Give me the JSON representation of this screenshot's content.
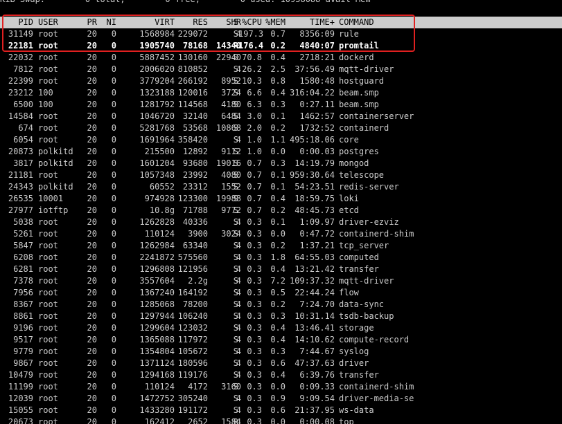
{
  "summary_line": "KiB Swap:        0 total,        0 free,        0 used. 10958088 avail Mem",
  "columns": {
    "pid": "PID",
    "user": "USER",
    "pr": "PR",
    "ni": "NI",
    "virt": "VIRT",
    "res": "RES",
    "shr": "SHR",
    "s": "S",
    "cpu": "%CPU",
    "mem": "%MEM",
    "time": "TIME+",
    "command": "COMMAND"
  },
  "processes": [
    {
      "pid": "31149",
      "user": "root",
      "pr": "20",
      "ni": "0",
      "virt": "1568984",
      "res": "229072",
      "shr": "4",
      "s": "S",
      "cpu": "197.3",
      "mem": "0.7",
      "time": "8356:09",
      "command": "rule",
      "bold": false
    },
    {
      "pid": "22181",
      "user": "root",
      "pr": "20",
      "ni": "0",
      "virt": "1905740",
      "res": "78168",
      "shr": "14340",
      "s": "R",
      "cpu": "176.4",
      "mem": "0.2",
      "time": "4840:07",
      "command": "promtail",
      "bold": true
    },
    {
      "pid": "22032",
      "user": "root",
      "pr": "20",
      "ni": "0",
      "virt": "5887452",
      "res": "130160",
      "shr": "22940",
      "s": "S",
      "cpu": "70.8",
      "mem": "0.4",
      "time": "2718:21",
      "command": "dockerd",
      "bold": false
    },
    {
      "pid": "7812",
      "user": "root",
      "pr": "20",
      "ni": "0",
      "virt": "2006020",
      "res": "810852",
      "shr": "4",
      "s": "S",
      "cpu": "26.2",
      "mem": "2.5",
      "time": "37:56.49",
      "command": "mqtt-driver",
      "bold": false
    },
    {
      "pid": "22399",
      "user": "root",
      "pr": "20",
      "ni": "0",
      "virt": "3779204",
      "res": "266192",
      "shr": "8952",
      "s": "S",
      "cpu": "10.3",
      "mem": "0.8",
      "time": "1580:48",
      "command": "hostguard",
      "bold": false
    },
    {
      "pid": "23212",
      "user": "100",
      "pr": "20",
      "ni": "0",
      "virt": "1323188",
      "res": "120016",
      "shr": "3724",
      "s": "S",
      "cpu": "6.6",
      "mem": "0.4",
      "time": "316:04.22",
      "command": "beam.smp",
      "bold": false
    },
    {
      "pid": "6500",
      "user": "100",
      "pr": "20",
      "ni": "0",
      "virt": "1281792",
      "res": "114568",
      "shr": "4180",
      "s": "S",
      "cpu": "6.3",
      "mem": "0.3",
      "time": "0:27.11",
      "command": "beam.smp",
      "bold": false
    },
    {
      "pid": "14584",
      "user": "root",
      "pr": "20",
      "ni": "0",
      "virt": "1046720",
      "res": "32140",
      "shr": "6484",
      "s": "S",
      "cpu": "3.0",
      "mem": "0.1",
      "time": "1462:57",
      "command": "containerserver",
      "bold": false
    },
    {
      "pid": "674",
      "user": "root",
      "pr": "20",
      "ni": "0",
      "virt": "5281768",
      "res": "53568",
      "shr": "10868",
      "s": "S",
      "cpu": "2.0",
      "mem": "0.2",
      "time": "1732:52",
      "command": "containerd",
      "bold": false
    },
    {
      "pid": "6054",
      "user": "root",
      "pr": "20",
      "ni": "0",
      "virt": "1691964",
      "res": "358420",
      "shr": "4",
      "s": "S",
      "cpu": "1.0",
      "mem": "1.1",
      "time": "495:18.06",
      "command": "core",
      "bold": false
    },
    {
      "pid": "20873",
      "user": "polkitd",
      "pr": "20",
      "ni": "0",
      "virt": "215500",
      "res": "12892",
      "shr": "9112",
      "s": "S",
      "cpu": "1.0",
      "mem": "0.0",
      "time": "0:00.03",
      "command": "postgres",
      "bold": false
    },
    {
      "pid": "3817",
      "user": "polkitd",
      "pr": "20",
      "ni": "0",
      "virt": "1601204",
      "res": "93680",
      "shr": "19016",
      "s": "S",
      "cpu": "0.7",
      "mem": "0.3",
      "time": "14:19.79",
      "command": "mongod",
      "bold": false
    },
    {
      "pid": "21181",
      "user": "root",
      "pr": "20",
      "ni": "0",
      "virt": "1057348",
      "res": "23992",
      "shr": "4080",
      "s": "S",
      "cpu": "0.7",
      "mem": "0.1",
      "time": "959:30.64",
      "command": "telescope",
      "bold": false
    },
    {
      "pid": "24343",
      "user": "polkitd",
      "pr": "20",
      "ni": "0",
      "virt": "60552",
      "res": "23312",
      "shr": "1552",
      "s": "S",
      "cpu": "0.7",
      "mem": "0.1",
      "time": "54:23.51",
      "command": "redis-server",
      "bold": false
    },
    {
      "pid": "26535",
      "user": "10001",
      "pr": "20",
      "ni": "0",
      "virt": "974928",
      "res": "123300",
      "shr": "19988",
      "s": "S",
      "cpu": "0.7",
      "mem": "0.4",
      "time": "18:59.75",
      "command": "loki",
      "bold": false
    },
    {
      "pid": "27977",
      "user": "iotftp",
      "pr": "20",
      "ni": "0",
      "virt": "10.8g",
      "res": "71788",
      "shr": "9772",
      "s": "S",
      "cpu": "0.7",
      "mem": "0.2",
      "time": "48:45.73",
      "command": "etcd",
      "bold": false
    },
    {
      "pid": "5038",
      "user": "root",
      "pr": "20",
      "ni": "0",
      "virt": "1262828",
      "res": "40336",
      "shr": "4",
      "s": "S",
      "cpu": "0.3",
      "mem": "0.1",
      "time": "1:09.97",
      "command": "driver-ezviz",
      "bold": false
    },
    {
      "pid": "5261",
      "user": "root",
      "pr": "20",
      "ni": "0",
      "virt": "110124",
      "res": "3900",
      "shr": "3024",
      "s": "S",
      "cpu": "0.3",
      "mem": "0.0",
      "time": "0:47.72",
      "command": "containerd-shim",
      "bold": false
    },
    {
      "pid": "5847",
      "user": "root",
      "pr": "20",
      "ni": "0",
      "virt": "1262984",
      "res": "63340",
      "shr": "4",
      "s": "S",
      "cpu": "0.3",
      "mem": "0.2",
      "time": "1:37.21",
      "command": "tcp_server",
      "bold": false
    },
    {
      "pid": "6208",
      "user": "root",
      "pr": "20",
      "ni": "0",
      "virt": "2241872",
      "res": "575560",
      "shr": "4",
      "s": "S",
      "cpu": "0.3",
      "mem": "1.8",
      "time": "64:55.03",
      "command": "computed",
      "bold": false
    },
    {
      "pid": "6281",
      "user": "root",
      "pr": "20",
      "ni": "0",
      "virt": "1296808",
      "res": "121956",
      "shr": "4",
      "s": "S",
      "cpu": "0.3",
      "mem": "0.4",
      "time": "13:21.42",
      "command": "transfer",
      "bold": false
    },
    {
      "pid": "7378",
      "user": "root",
      "pr": "20",
      "ni": "0",
      "virt": "3557604",
      "res": "2.2g",
      "shr": "4",
      "s": "S",
      "cpu": "0.3",
      "mem": "7.2",
      "time": "109:37.32",
      "command": "mqtt-driver",
      "bold": false
    },
    {
      "pid": "7956",
      "user": "root",
      "pr": "20",
      "ni": "0",
      "virt": "1367240",
      "res": "164192",
      "shr": "4",
      "s": "S",
      "cpu": "0.3",
      "mem": "0.5",
      "time": "22:44.24",
      "command": "flow",
      "bold": false
    },
    {
      "pid": "8367",
      "user": "root",
      "pr": "20",
      "ni": "0",
      "virt": "1285068",
      "res": "78200",
      "shr": "4",
      "s": "S",
      "cpu": "0.3",
      "mem": "0.2",
      "time": "7:24.70",
      "command": "data-sync",
      "bold": false
    },
    {
      "pid": "8861",
      "user": "root",
      "pr": "20",
      "ni": "0",
      "virt": "1297944",
      "res": "106240",
      "shr": "4",
      "s": "S",
      "cpu": "0.3",
      "mem": "0.3",
      "time": "10:31.14",
      "command": "tsdb-backup",
      "bold": false
    },
    {
      "pid": "9196",
      "user": "root",
      "pr": "20",
      "ni": "0",
      "virt": "1299604",
      "res": "123032",
      "shr": "4",
      "s": "S",
      "cpu": "0.3",
      "mem": "0.4",
      "time": "13:46.41",
      "command": "storage",
      "bold": false
    },
    {
      "pid": "9517",
      "user": "root",
      "pr": "20",
      "ni": "0",
      "virt": "1365088",
      "res": "117972",
      "shr": "4",
      "s": "S",
      "cpu": "0.3",
      "mem": "0.4",
      "time": "14:10.62",
      "command": "compute-record",
      "bold": false
    },
    {
      "pid": "9779",
      "user": "root",
      "pr": "20",
      "ni": "0",
      "virt": "1354804",
      "res": "105672",
      "shr": "4",
      "s": "S",
      "cpu": "0.3",
      "mem": "0.3",
      "time": "7:44.67",
      "command": "syslog",
      "bold": false
    },
    {
      "pid": "9867",
      "user": "root",
      "pr": "20",
      "ni": "0",
      "virt": "1371124",
      "res": "180596",
      "shr": "4",
      "s": "S",
      "cpu": "0.3",
      "mem": "0.6",
      "time": "47:37.63",
      "command": "driver",
      "bold": false
    },
    {
      "pid": "10479",
      "user": "root",
      "pr": "20",
      "ni": "0",
      "virt": "1294168",
      "res": "119176",
      "shr": "4",
      "s": "S",
      "cpu": "0.3",
      "mem": "0.4",
      "time": "6:39.76",
      "command": "transfer",
      "bold": false
    },
    {
      "pid": "11199",
      "user": "root",
      "pr": "20",
      "ni": "0",
      "virt": "110124",
      "res": "4172",
      "shr": "3160",
      "s": "S",
      "cpu": "0.3",
      "mem": "0.0",
      "time": "0:09.33",
      "command": "containerd-shim",
      "bold": false
    },
    {
      "pid": "12039",
      "user": "root",
      "pr": "20",
      "ni": "0",
      "virt": "1472752",
      "res": "305240",
      "shr": "4",
      "s": "S",
      "cpu": "0.3",
      "mem": "0.9",
      "time": "9:09.54",
      "command": "driver-media-se",
      "bold": false
    },
    {
      "pid": "15055",
      "user": "root",
      "pr": "20",
      "ni": "0",
      "virt": "1433280",
      "res": "191172",
      "shr": "4",
      "s": "S",
      "cpu": "0.3",
      "mem": "0.6",
      "time": "21:37.95",
      "command": "ws-data",
      "bold": false
    },
    {
      "pid": "20673",
      "user": "root",
      "pr": "20",
      "ni": "0",
      "virt": "162412",
      "res": "2652",
      "shr": "1584",
      "s": "R",
      "cpu": "0.3",
      "mem": "0.0",
      "time": "0:00.08",
      "command": "top",
      "bold": false
    }
  ],
  "colors": {
    "background": "#000000",
    "text": "#cccccc",
    "header_bg": "#cccccc",
    "header_text": "#000000",
    "highlight": "#e02020"
  }
}
